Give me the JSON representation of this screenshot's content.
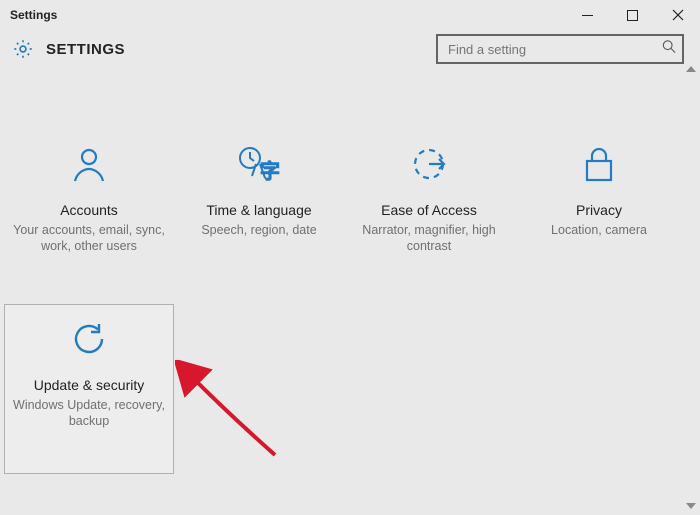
{
  "window": {
    "title": "Settings"
  },
  "header": {
    "title": "SETTINGS"
  },
  "search": {
    "placeholder": "Find a setting"
  },
  "tiles": [
    {
      "id": "accounts",
      "title": "Accounts",
      "desc": "Your accounts, email, sync, work, other users"
    },
    {
      "id": "time-language",
      "title": "Time & language",
      "desc": "Speech, region, date"
    },
    {
      "id": "ease-of-access",
      "title": "Ease of Access",
      "desc": "Narrator, magnifier, high contrast"
    },
    {
      "id": "privacy",
      "title": "Privacy",
      "desc": "Location, camera"
    },
    {
      "id": "update-security",
      "title": "Update & security",
      "desc": "Windows Update, recovery, backup"
    }
  ],
  "colors": {
    "accent": "#247bc3",
    "annotation": "#d6172e"
  }
}
